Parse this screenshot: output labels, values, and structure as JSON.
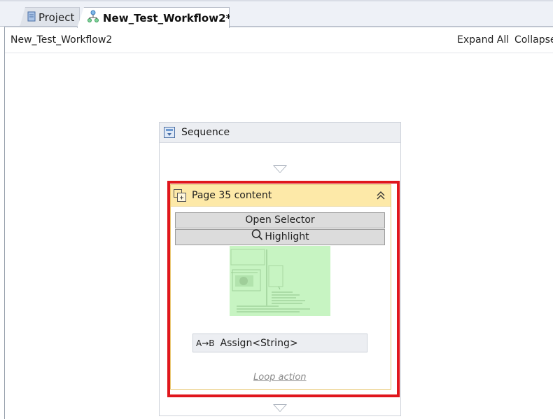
{
  "tabs": [
    {
      "label": "Project",
      "active": false
    },
    {
      "label": "New_Test_Workflow2*",
      "active": true
    }
  ],
  "designer": {
    "breadcrumb": "New_Test_Workflow2",
    "expand_all": "Expand All",
    "collapse": "Collapse"
  },
  "sequence": {
    "title": "Sequence"
  },
  "activity": {
    "title": "Page 35 content",
    "open_selector": "Open Selector",
    "highlight": "Highlight",
    "assign_icon_text": "A→B",
    "assign_label": "Assign<String>",
    "loop_action": "Loop action"
  },
  "colors": {
    "highlight_frame": "#e0161c",
    "card_header": "#fde9a8",
    "preview_bg": "#c9f5c4"
  },
  "icons": {
    "project_tab": "document-icon",
    "workflow_tab": "workflow-icon",
    "sequence": "sequence-icon",
    "activity": "activity-icon",
    "collapse": "chevron-double-up-icon",
    "highlight": "magnifier-icon"
  }
}
